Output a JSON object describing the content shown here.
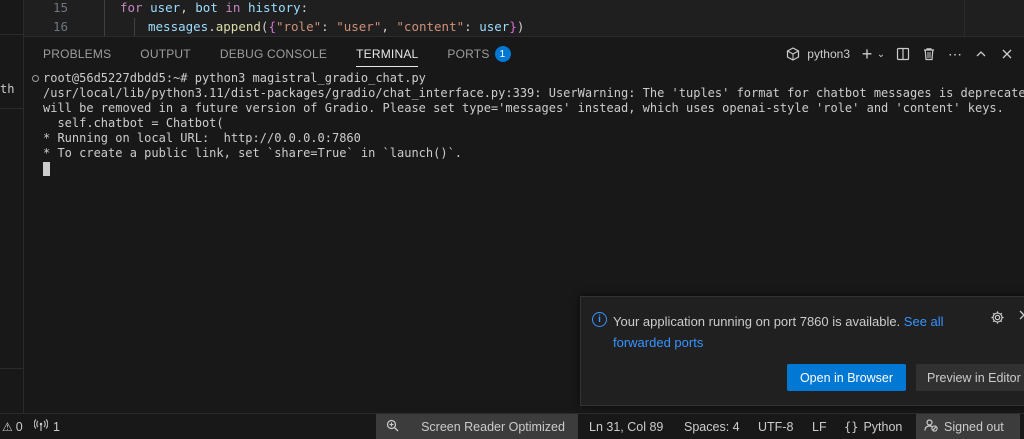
{
  "editor": {
    "lines": [
      {
        "number": "15",
        "text": "for user, bot in history:"
      },
      {
        "number": "16",
        "text": "messages.append({\"role\": \"user\", \"content\": user})"
      }
    ]
  },
  "left_strip": {
    "fragment": "th"
  },
  "panel": {
    "tabs": [
      {
        "label": "PROBLEMS"
      },
      {
        "label": "OUTPUT"
      },
      {
        "label": "DEBUG CONSOLE"
      },
      {
        "label": "TERMINAL"
      },
      {
        "label": "PORTS",
        "badge": "1"
      }
    ],
    "active_tab": "TERMINAL",
    "terminal_name": "python3",
    "icons": [
      "terminal-icon",
      "plus-icon",
      "chevron-down-icon",
      "split-icon",
      "trash-icon",
      "ellipsis-icon",
      "chevron-up-icon",
      "close-icon"
    ]
  },
  "terminal": {
    "lines": [
      "root@56d5227dbdd5:~# python3 magistral_gradio_chat.py",
      "/usr/local/lib/python3.11/dist-packages/gradio/chat_interface.py:339: UserWarning: The 'tuples' format for chatbot messages is deprecated",
      "will be removed in a future version of Gradio. Please set type='messages' instead, which uses openai-style 'role' and 'content' keys.",
      "  self.chatbot = Chatbot(",
      "* Running on local URL:  http://0.0.0.0:7860",
      "* To create a public link, set `share=True` in `launch()`."
    ]
  },
  "notification": {
    "message": "Your application running on port 7860 is available.",
    "link_part1": "See all",
    "link_part2": "forwarded ports",
    "primary_button": "Open in Browser",
    "secondary_button": "Preview in Editor"
  },
  "statusbar": {
    "errors": "0",
    "ports": "1",
    "screen_reader": "Screen Reader Optimized",
    "position": "Ln 31, Col 89",
    "spaces": "Spaces: 4",
    "encoding": "UTF-8",
    "eol": "LF",
    "language": "Python",
    "account": "Signed out"
  },
  "colors": {
    "accent": "#0078d4",
    "link": "#3794ff",
    "background": "#181818"
  }
}
